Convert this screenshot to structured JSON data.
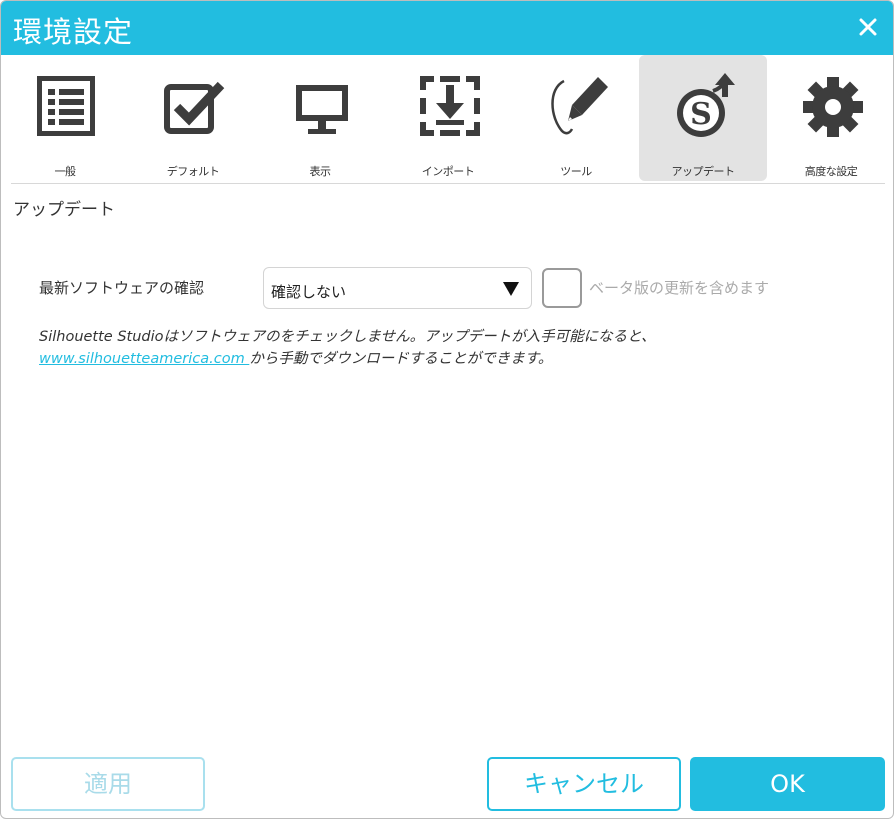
{
  "window": {
    "title": "環境設定"
  },
  "toolbar": {
    "items": [
      {
        "label": "一般",
        "icon": "list-icon"
      },
      {
        "label": "デフォルト",
        "icon": "checkbox-icon"
      },
      {
        "label": "表示",
        "icon": "monitor-icon"
      },
      {
        "label": "インポート",
        "icon": "import-icon"
      },
      {
        "label": "ツール",
        "icon": "pen-icon"
      },
      {
        "label": "アップデート",
        "icon": "update-icon",
        "active": true
      },
      {
        "label": "高度な設定",
        "icon": "gear-icon"
      }
    ]
  },
  "panel": {
    "heading": "アップデート",
    "check_label": "最新ソフトウェアの確認",
    "check_select": {
      "value": "確認しない"
    },
    "beta_checkbox": {
      "label": "ベータ版の更新を含めます",
      "checked": false
    },
    "info_text_1": "Silhouette Studioはソフトウェアのをチェックしません。アップデートが入手可能になると、",
    "info_link": "www.silhouetteamerica.com ",
    "info_text_2": "から手動でダウンロードすることができます。"
  },
  "buttons": {
    "apply": "適用",
    "cancel": "キャンセル",
    "ok": "OK"
  },
  "colors": {
    "accent": "#22bde0",
    "active_tab_bg": "#e3e3e3",
    "icon_dark": "#3d3d3d"
  }
}
